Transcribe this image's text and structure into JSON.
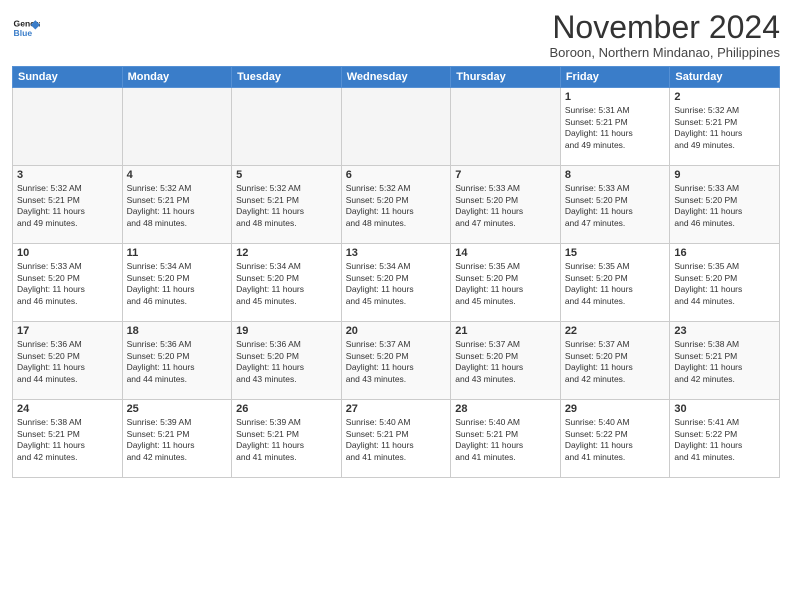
{
  "header": {
    "logo_line1": "General",
    "logo_line2": "Blue",
    "month": "November 2024",
    "location": "Boroon, Northern Mindanao, Philippines"
  },
  "weekdays": [
    "Sunday",
    "Monday",
    "Tuesday",
    "Wednesday",
    "Thursday",
    "Friday",
    "Saturday"
  ],
  "weeks": [
    [
      {
        "day": "",
        "info": ""
      },
      {
        "day": "",
        "info": ""
      },
      {
        "day": "",
        "info": ""
      },
      {
        "day": "",
        "info": ""
      },
      {
        "day": "",
        "info": ""
      },
      {
        "day": "1",
        "info": "Sunrise: 5:31 AM\nSunset: 5:21 PM\nDaylight: 11 hours\nand 49 minutes."
      },
      {
        "day": "2",
        "info": "Sunrise: 5:32 AM\nSunset: 5:21 PM\nDaylight: 11 hours\nand 49 minutes."
      }
    ],
    [
      {
        "day": "3",
        "info": "Sunrise: 5:32 AM\nSunset: 5:21 PM\nDaylight: 11 hours\nand 49 minutes."
      },
      {
        "day": "4",
        "info": "Sunrise: 5:32 AM\nSunset: 5:21 PM\nDaylight: 11 hours\nand 48 minutes."
      },
      {
        "day": "5",
        "info": "Sunrise: 5:32 AM\nSunset: 5:21 PM\nDaylight: 11 hours\nand 48 minutes."
      },
      {
        "day": "6",
        "info": "Sunrise: 5:32 AM\nSunset: 5:20 PM\nDaylight: 11 hours\nand 48 minutes."
      },
      {
        "day": "7",
        "info": "Sunrise: 5:33 AM\nSunset: 5:20 PM\nDaylight: 11 hours\nand 47 minutes."
      },
      {
        "day": "8",
        "info": "Sunrise: 5:33 AM\nSunset: 5:20 PM\nDaylight: 11 hours\nand 47 minutes."
      },
      {
        "day": "9",
        "info": "Sunrise: 5:33 AM\nSunset: 5:20 PM\nDaylight: 11 hours\nand 46 minutes."
      }
    ],
    [
      {
        "day": "10",
        "info": "Sunrise: 5:33 AM\nSunset: 5:20 PM\nDaylight: 11 hours\nand 46 minutes."
      },
      {
        "day": "11",
        "info": "Sunrise: 5:34 AM\nSunset: 5:20 PM\nDaylight: 11 hours\nand 46 minutes."
      },
      {
        "day": "12",
        "info": "Sunrise: 5:34 AM\nSunset: 5:20 PM\nDaylight: 11 hours\nand 45 minutes."
      },
      {
        "day": "13",
        "info": "Sunrise: 5:34 AM\nSunset: 5:20 PM\nDaylight: 11 hours\nand 45 minutes."
      },
      {
        "day": "14",
        "info": "Sunrise: 5:35 AM\nSunset: 5:20 PM\nDaylight: 11 hours\nand 45 minutes."
      },
      {
        "day": "15",
        "info": "Sunrise: 5:35 AM\nSunset: 5:20 PM\nDaylight: 11 hours\nand 44 minutes."
      },
      {
        "day": "16",
        "info": "Sunrise: 5:35 AM\nSunset: 5:20 PM\nDaylight: 11 hours\nand 44 minutes."
      }
    ],
    [
      {
        "day": "17",
        "info": "Sunrise: 5:36 AM\nSunset: 5:20 PM\nDaylight: 11 hours\nand 44 minutes."
      },
      {
        "day": "18",
        "info": "Sunrise: 5:36 AM\nSunset: 5:20 PM\nDaylight: 11 hours\nand 44 minutes."
      },
      {
        "day": "19",
        "info": "Sunrise: 5:36 AM\nSunset: 5:20 PM\nDaylight: 11 hours\nand 43 minutes."
      },
      {
        "day": "20",
        "info": "Sunrise: 5:37 AM\nSunset: 5:20 PM\nDaylight: 11 hours\nand 43 minutes."
      },
      {
        "day": "21",
        "info": "Sunrise: 5:37 AM\nSunset: 5:20 PM\nDaylight: 11 hours\nand 43 minutes."
      },
      {
        "day": "22",
        "info": "Sunrise: 5:37 AM\nSunset: 5:20 PM\nDaylight: 11 hours\nand 42 minutes."
      },
      {
        "day": "23",
        "info": "Sunrise: 5:38 AM\nSunset: 5:21 PM\nDaylight: 11 hours\nand 42 minutes."
      }
    ],
    [
      {
        "day": "24",
        "info": "Sunrise: 5:38 AM\nSunset: 5:21 PM\nDaylight: 11 hours\nand 42 minutes."
      },
      {
        "day": "25",
        "info": "Sunrise: 5:39 AM\nSunset: 5:21 PM\nDaylight: 11 hours\nand 42 minutes."
      },
      {
        "day": "26",
        "info": "Sunrise: 5:39 AM\nSunset: 5:21 PM\nDaylight: 11 hours\nand 41 minutes."
      },
      {
        "day": "27",
        "info": "Sunrise: 5:40 AM\nSunset: 5:21 PM\nDaylight: 11 hours\nand 41 minutes."
      },
      {
        "day": "28",
        "info": "Sunrise: 5:40 AM\nSunset: 5:21 PM\nDaylight: 11 hours\nand 41 minutes."
      },
      {
        "day": "29",
        "info": "Sunrise: 5:40 AM\nSunset: 5:22 PM\nDaylight: 11 hours\nand 41 minutes."
      },
      {
        "day": "30",
        "info": "Sunrise: 5:41 AM\nSunset: 5:22 PM\nDaylight: 11 hours\nand 41 minutes."
      }
    ]
  ]
}
